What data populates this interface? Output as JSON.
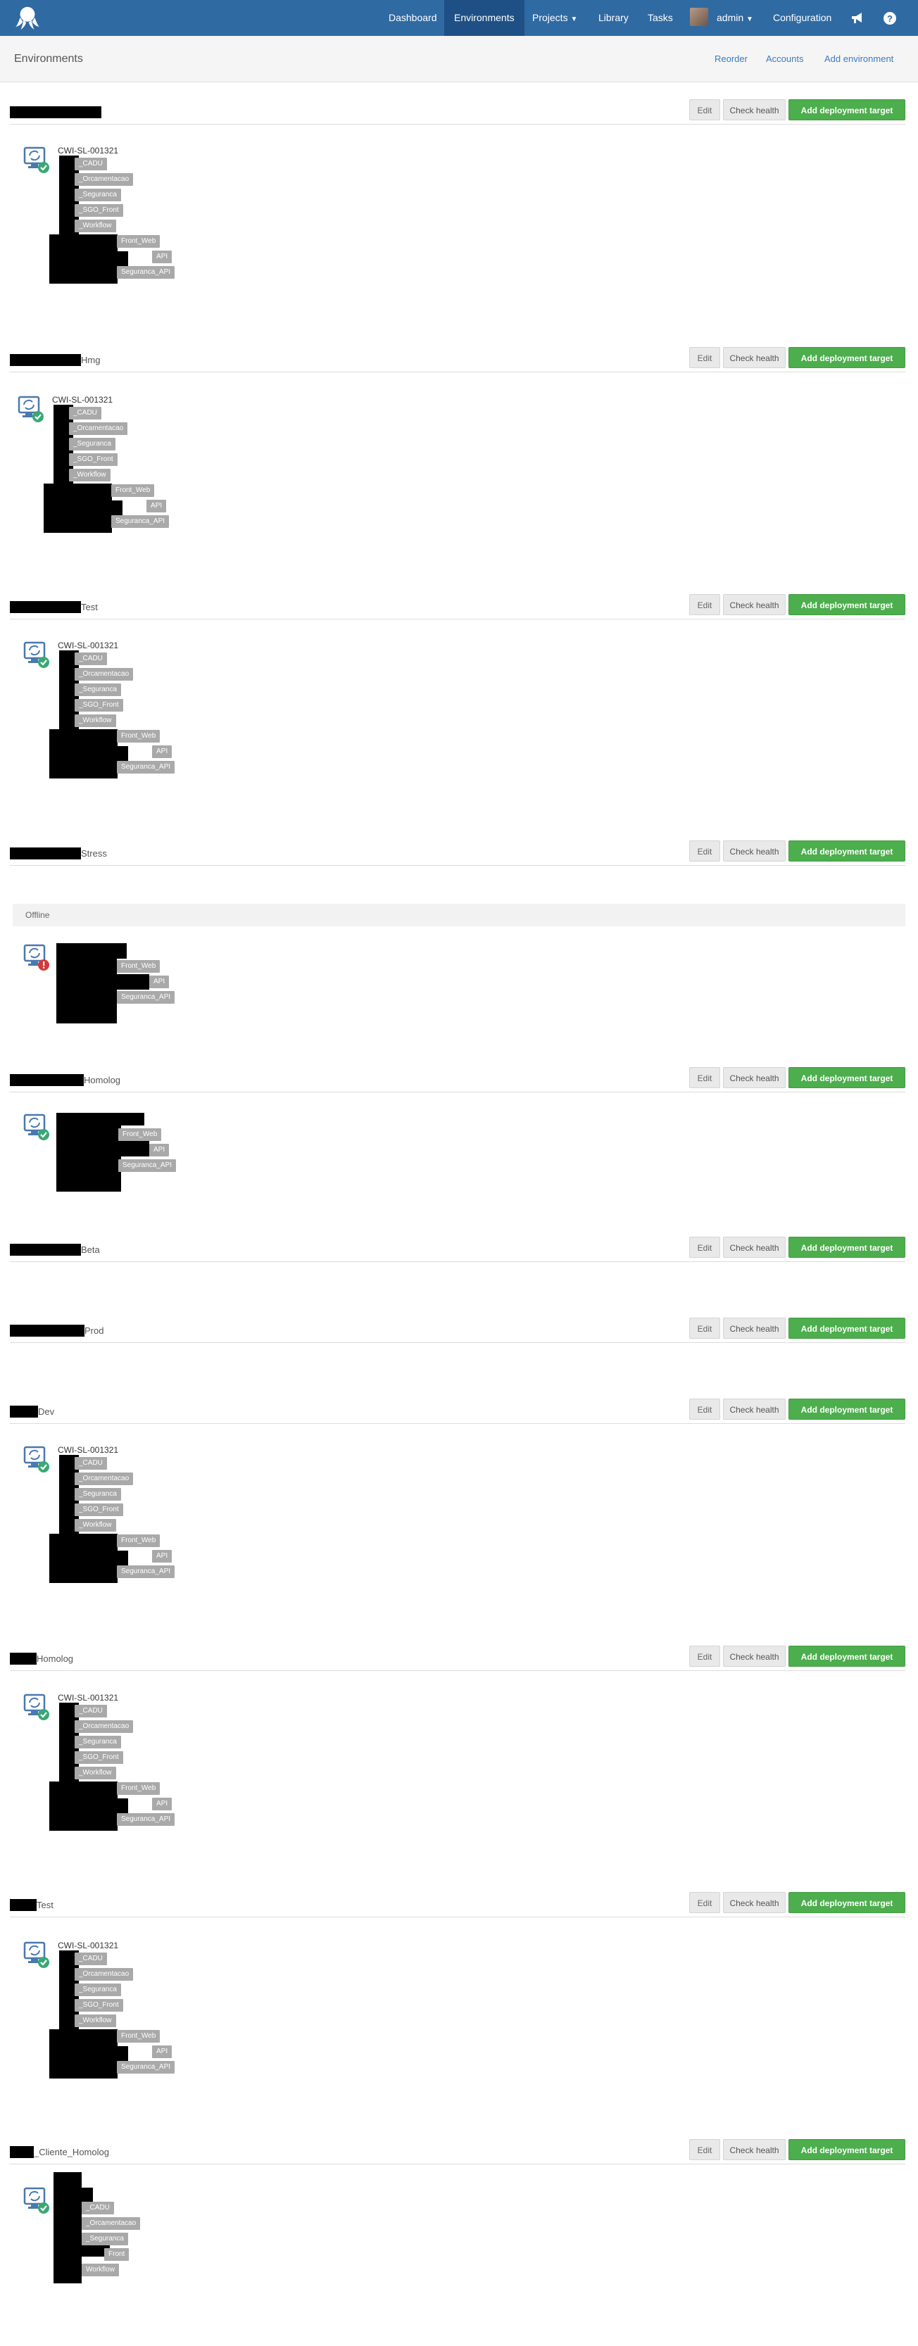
{
  "nav": {
    "items": [
      {
        "label": "Dashboard"
      },
      {
        "label": "Environments"
      },
      {
        "label": "Projects"
      },
      {
        "label": "Library"
      },
      {
        "label": "Tasks"
      },
      {
        "label": "admin"
      },
      {
        "label": "Configuration"
      }
    ]
  },
  "header": {
    "title": "Environments",
    "links": [
      {
        "label": "Reorder"
      },
      {
        "label": "Accounts"
      },
      {
        "label": "Add environment"
      }
    ]
  },
  "buttons": {
    "edit": "Edit",
    "check_health": "Check health",
    "add_target": "Add deployment target"
  },
  "envs": [
    {
      "suffix": "",
      "machine": "CWI-SL-001321"
    },
    {
      "suffix": "Hmg",
      "machine": "CWI-SL-001321"
    },
    {
      "suffix": "Test",
      "machine": "CWI-SL-001321"
    },
    {
      "suffix": "Stress",
      "offline_label": "Offline"
    },
    {
      "suffix": "Homolog"
    },
    {
      "suffix": "Beta"
    },
    {
      "suffix": "Prod"
    },
    {
      "suffix": "Dev",
      "machine": "CWI-SL-001321"
    },
    {
      "suffix": "Homolog",
      "machine": "CWI-SL-001321"
    },
    {
      "suffix": "Test",
      "machine": "CWI-SL-001321"
    },
    {
      "suffix": "_Cliente_Homolog"
    }
  ],
  "roles": {
    "full": [
      "_CADU",
      "_Orcamentacao",
      "_Seguranca",
      "_SGO_Front",
      "_Workflow",
      "Front_Web",
      "API",
      "Seguranca_API"
    ],
    "short": [
      "Front_Web",
      "API",
      "Seguranca_API"
    ],
    "cliente": [
      "_CADU",
      "_Orcamentacao",
      "_Seguranca",
      "Front",
      "Workflow"
    ]
  },
  "colors": {
    "nav": "#2f6aa3",
    "nav_active": "#1f5085",
    "add_button": "#4cae4c",
    "role_tag": "#a9a9a9",
    "healthy": "#3aa873",
    "error": "#d23b3b"
  }
}
